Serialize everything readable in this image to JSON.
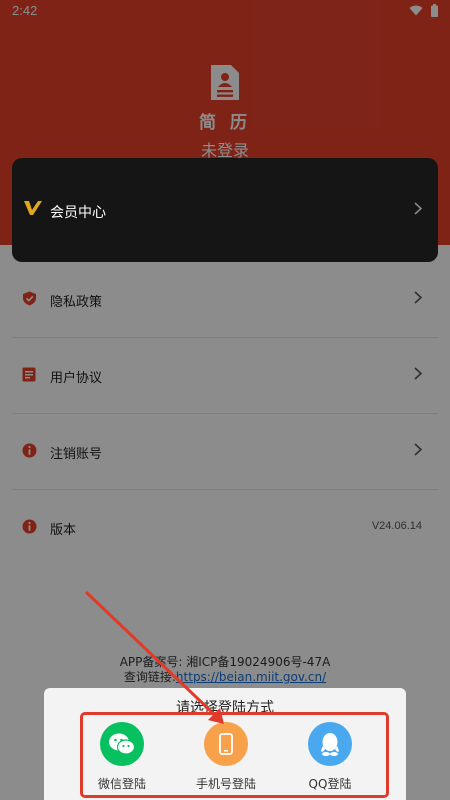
{
  "status_bar": {
    "time": "2:42"
  },
  "header": {
    "app_name": "简 历",
    "login_status": "未登录"
  },
  "vip": {
    "label": "会员中心"
  },
  "menu": [
    {
      "label": "隐私政策",
      "icon": "shield-icon"
    },
    {
      "label": "用户协议",
      "icon": "document-icon"
    },
    {
      "label": "注销账号",
      "icon": "info-icon"
    },
    {
      "label": "版本",
      "icon": "info-icon",
      "value": "V24.06.14"
    }
  ],
  "footer": {
    "icp_text": "APP备案号: 湘ICP备19024906号-47A",
    "query_prefix": "查询链接:",
    "query_link": "https://beian.miit.gov.cn/"
  },
  "login_sheet": {
    "title": "请选择登陆方式",
    "options": [
      {
        "label": "微信登陆",
        "icon": "wechat-icon",
        "color": "#07c160"
      },
      {
        "label": "手机号登陆",
        "icon": "phone-icon",
        "color": "#f7a14a"
      },
      {
        "label": "QQ登陆",
        "icon": "qq-icon",
        "color": "#4aa9ee"
      }
    ]
  },
  "colors": {
    "brand_red": "#e8412b",
    "vip_gold": "#e0a81e"
  }
}
